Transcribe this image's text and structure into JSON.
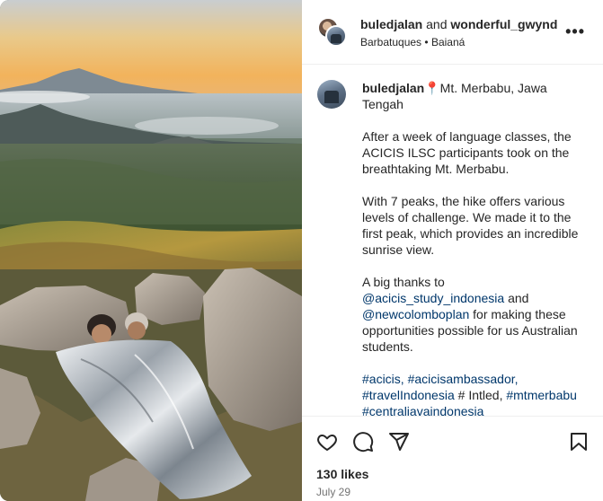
{
  "header": {
    "user1": "buledjalan",
    "connector": "and",
    "user2": "wonderful_gwyndor",
    "location_primary": "Barbatuques",
    "separator": "•",
    "location_secondary": "Baianá",
    "more_icon": "more-horizontal-icon"
  },
  "caption": {
    "username": "buledjalan",
    "pin_icon": "📍",
    "location_text": "Mt. Merbabu, Jawa Tengah",
    "para1": "After a week of language classes, the ACICIS ILSC participants took on the breathtaking Mt. Merbabu.",
    "para2": "With 7 peaks, the hike offers various levels of challenge. We made it to the first peak, which provides an incredible sunrise view.",
    "para3_start": "A big thanks to",
    "mention1": "@acicis_study_indonesia",
    "para3_and": "and",
    "mention2": "@newcolomboplan",
    "para3_end": "for making these opportunities possible for us Australian students.",
    "tag1": "#acicis,",
    "tag2": "#acicisambassador,",
    "tag3": "#travelIndonesia",
    "tag3_suffix": "# Intled,",
    "tag4": "#mtmerbabu",
    "tag5": "#centraljavaindonesia"
  },
  "actions": {
    "icons": [
      "heart-icon",
      "comment-icon",
      "share-icon",
      "bookmark-icon"
    ],
    "likes": "130 likes",
    "date": "July 29"
  },
  "colors": {
    "link": "#00376b",
    "muted": "#737373",
    "text": "#262626",
    "divider": "#efefef"
  }
}
